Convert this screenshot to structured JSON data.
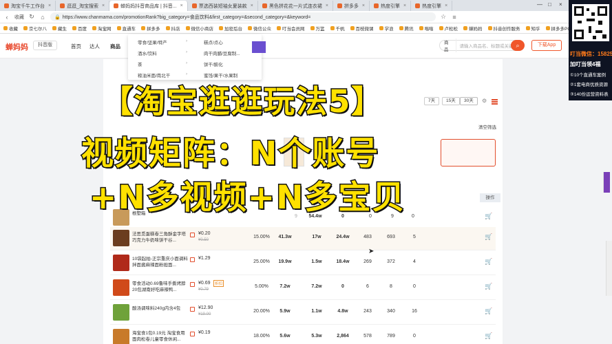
{
  "browser": {
    "tabs": [
      {
        "label": "淘宝千牛工作台",
        "active": false
      },
      {
        "label": "逛逛_淘宝搜索",
        "active": false
      },
      {
        "label": "蝉妈妈抖音商品库 | 抖音...",
        "active": true
      },
      {
        "label": "票选西装短袖女夏装款",
        "active": false
      },
      {
        "label": "黑色拼花花一片式连衣裙",
        "active": false
      },
      {
        "label": "拼多多",
        "active": false
      },
      {
        "label": "热度引擎",
        "active": false
      },
      {
        "label": "热度引擎",
        "active": false
      }
    ],
    "back_label": "收藏",
    "url": "https://www.chanmama.com/promotionRank?big_category=食品饮料&first_category=&second_category=&keyword=",
    "bookmarks": [
      "收藏",
      "京七尔八",
      "藏生",
      "百度",
      "淘宝网",
      "直通车",
      "拼多多",
      "抖店",
      "微信小商店",
      "加密后台",
      "微信公众",
      "叮当会员网",
      "万篮",
      "千帆",
      "百枝微课",
      "学浪",
      "腾讯",
      "嗡嗡",
      "卢松松",
      "蝉妈妈",
      "抖音创作服务",
      "知乎",
      "拼多多PC端",
      "电霸"
    ]
  },
  "site": {
    "logo": "蝉妈妈",
    "version": "抖音版",
    "nav": [
      "首页",
      "达人",
      "商品"
    ],
    "menu_left": [
      "零食/坚果/特产",
      "酒水/饮料",
      "茶",
      "粮油米面/南北干"
    ],
    "menu_right": [
      "糕点/点心",
      "肉干肉脯/豆腐制...",
      "饼干/膨化",
      "蜜饯/果干/水果制"
    ],
    "search_category": "商品",
    "search_placeholder": "请输入商品名、标题或关键词搜索",
    "download_label": "下载App",
    "period_chips": [
      "7天",
      "15天",
      "30天"
    ],
    "clear_filter": "清空筛选",
    "operation_header": "操作"
  },
  "overlay": {
    "line1": "【淘宝逛逛玩法5】",
    "line2": "视频矩阵：N个账号",
    "line3": "+N多视频+N多宝贝"
  },
  "products": [
    {
      "title": "根墅箱",
      "price": "",
      "oprice": "",
      "badge": "",
      "rate": "",
      "c1": "9",
      "c2": "",
      "c3": "54.4w",
      "c4": "0",
      "c5": "0",
      "c6": "9",
      "c7": "0",
      "thumb": "#c89a5a"
    },
    {
      "title": "法思觅蛋糕卷三角酥金字塔巧克力牛奶味饼干谷...",
      "price": "¥0.20",
      "oprice": "¥0.50",
      "badge": "",
      "rate": "15.00%",
      "c1": "41.3w",
      "c2": "17w",
      "c3": "24.4w",
      "c4": "483",
      "c5": "693",
      "c6": "5",
      "c7": "",
      "thumb": "#6b3d1f"
    },
    {
      "title": "10袋起拍-正宗重庆小面调料拌面酱麻辣面粉担面...",
      "price": "¥1.29",
      "oprice": "",
      "badge": "",
      "rate": "25.00%",
      "c1": "19.9w",
      "c2": "1.5w",
      "c3": "18.4w",
      "c4": "269",
      "c5": "372",
      "c6": "4",
      "c7": "",
      "thumb": "#b02a1a"
    },
    {
      "title": "零食活动0.69鲁味手撕烤脖20包湖南好吃麻辣鸭...",
      "price": "¥0.69",
      "oprice": "¥0.79",
      "badge": "折扣",
      "rate": "5.00%",
      "c1": "7.2w",
      "c2": "7.2w",
      "c3": "0",
      "c4": "6",
      "c5": "8",
      "c6": "0",
      "c7": "",
      "thumb": "#d04a1a"
    },
    {
      "title": "酸汤调味料240g内含4包",
      "price": "¥12.90",
      "oprice": "¥19.00",
      "badge": "",
      "rate": "20.00%",
      "c1": "5.9w",
      "c2": "1.1w",
      "c3": "4.8w",
      "c4": "243",
      "c5": "340",
      "c6": "16",
      "c7": "",
      "thumb": "#6fa23a"
    },
    {
      "title": "海宝食1包0.19元 淘宝食用面肉松卷儿童零食休闲...",
      "price": "¥0.19",
      "oprice": "",
      "badge": "",
      "rate": "18.00%",
      "c1": "5.6w",
      "c2": "5.3w",
      "c3": "2,864",
      "c4": "578",
      "c5": "789",
      "c6": "0",
      "c7": "",
      "thumb": "#c87a2a"
    }
  ],
  "ad": {
    "status": "叮当微信：15825",
    "title": "加叮当领4福",
    "lines": [
      "①10个直通车案例",
      "②1套电商优质资源",
      "③140份运营资料表"
    ]
  }
}
